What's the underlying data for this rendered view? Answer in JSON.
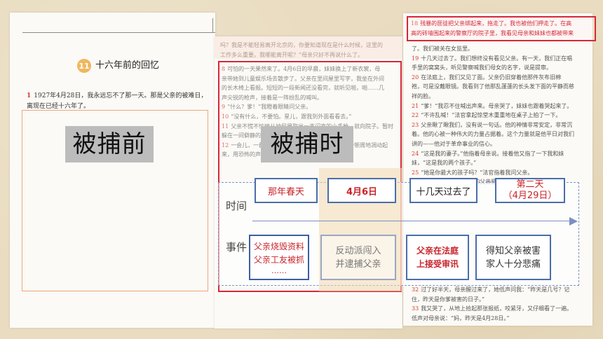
{
  "left_page": {
    "lesson_number": "11",
    "lesson_title": "十六年前的回忆",
    "para_number": "1",
    "para_text": "1927年4月28日，我永远忘不了那一天。那是父亲的被难日，离现在已经十六年了。"
  },
  "labels": {
    "before": "被捕前",
    "during": "被捕时"
  },
  "mid_page": {
    "top_lines": [
      {
        "num": "",
        "text": "吗？我是不能轻易离开北京的，你要知道现在是什么时候，这里的"
      },
      {
        "num": "",
        "text": "工作多么重要。我哪能离开呢？”母亲只好不再说什么了。"
      }
    ],
    "lines": [
      {
        "num": "8",
        "text": "可怕的一天果然来了。4月6日的早晨，妹妹换上了新衣裳，母"
      },
      {
        "num": "",
        "text": "亲带她到儿童娱乐场去散步了。父亲在里间屋里写字，我坐在外间"
      },
      {
        "num": "",
        "text": "的长木椅上看报。短短的一段新闻还没看完，就听见啪，啪……几"
      },
      {
        "num": "",
        "text": "声尖锐的枪声，接着是一阵纷乱的喊叫。"
      },
      {
        "num": "9",
        "text": "“什么？爹！”我瞪着眼睛问父亲。"
      },
      {
        "num": "10",
        "text": "“没有什么，不要怕。星儿，跟我到外面看看去。”"
      },
      {
        "num": "11",
        "text": "父亲不慌不忙地从抽屉里取出一支闪亮的小手枪，就向院子。暂时"
      },
      {
        "num": "",
        "text": "躲在一间僻静的小屋里。"
      },
      {
        "num": "12",
        "text": "一会儿，一群匪徒从里面闯进来，对父亲进行了一顿周地凋动起"
      },
      {
        "num": "",
        "text": "来，用恐怖的声音命令……"
      }
    ]
  },
  "right_page": {
    "highlight_lines": [
      {
        "num": "18",
        "text": "残暴的匪徒把父亲绑起来，拖走了。我也被他们押走了。在高"
      },
      {
        "num": "",
        "text": "高的砖墙围起来的警察厅的院子里，我看见母亲和妹妹也都被带来"
      }
    ],
    "lines": [
      {
        "num": "",
        "text": "了。我们被关在女监里。"
      },
      {
        "num": "19",
        "text": "十几天过去了。我们想终没有看见父亲。有一天，我们正在唱"
      },
      {
        "num": "",
        "text": "手里的窝窝头，听见警察喊我们母女的名字，说是提审。"
      },
      {
        "num": "20",
        "text": "在法庭上，我们又见了面。父亲仍旧穿着他那件灰布旧棉"
      },
      {
        "num": "",
        "text": "袍，可是没戴眼镜。我看到了他那乱蓬蓬的长头发下面的平静而慈"
      },
      {
        "num": "",
        "text": "祥的脸。"
      },
      {
        "num": "21",
        "text": "“爹！”我忍不住喊出声来。母亲哭了，妹妹也跟着哭起来了。"
      },
      {
        "num": "22",
        "text": "“不许乱喊！”法官拿起惊堂木重重地在桌子上拍了一下。"
      },
      {
        "num": "23",
        "text": "父亲瞅了瞅我们，没有说一句话。他的神情非常安定，非常沉"
      },
      {
        "num": "",
        "text": "着。他的心被一种伟大的力量占据着。这个力量就是他平日对我们"
      },
      {
        "num": "",
        "text": "讲的——他对于革命事业的信心。"
      },
      {
        "num": "24",
        "text": "“这是我的妻子。”他指着母亲说。接着他又指了一下我和妹"
      },
      {
        "num": "",
        "text": "妹，“这是我的两个孩子。”"
      },
      {
        "num": "25",
        "text": "“她是你最大的孩子吗？”法官指着我问父亲。"
      },
      {
        "num": "26",
        "text": "“是的，我就是……我的父亲把你的母亲说了……"
      }
    ],
    "bottom_lines": [
      {
        "num": "32",
        "text": "过了好半天，母亲醒过来了，她低声问我：“昨天是几号？记"
      },
      {
        "num": "",
        "text": "住，昨天是你爹被害的日子。”"
      },
      {
        "num": "33",
        "text": "我又哭了，从地上拾起那张报纸，咬紧牙，又仔细看了一遍。"
      },
      {
        "num": "",
        "text": "低声对母亲说：“妈，昨天是4月28日。”"
      }
    ]
  },
  "timeline": {
    "time_label": "时间",
    "event_label": "事件",
    "times": {
      "t1": "那年春天",
      "t2": "4月6日",
      "t3": "十几天过去了",
      "t4_line1": "第二天",
      "t4_line2": "（4月29日）"
    },
    "events": {
      "e1_line1": "父亲烧毁资料",
      "e1_line2": "父亲工友被抓",
      "e1_more": "……",
      "e2_line1": "反动派闯入",
      "e2_line2": "并逮捕父亲",
      "e3_line1": "父亲在法庭",
      "e3_line2": "上接受审讯",
      "e4_line1": "得知父亲被害",
      "e4_line2": "家人十分悲痛"
    }
  },
  "colors": {
    "accent_red": "#d6283a",
    "box_blue": "#4a6ea9",
    "label_gray": "#bcbcbc",
    "highlight_tan": "#f3d8b0",
    "lesson_badge": "#f0b75e"
  }
}
